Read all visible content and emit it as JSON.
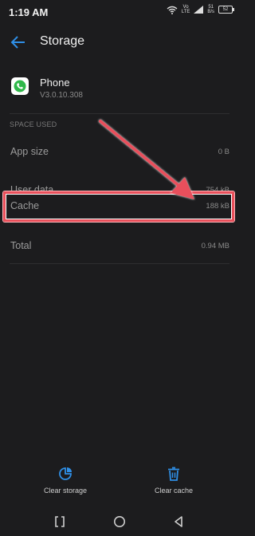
{
  "status_bar": {
    "time": "1:19 AM",
    "network_top": "Vo",
    "network_bottom": "LTE",
    "speed_top": "51",
    "speed_bottom": "B/s",
    "battery": "52"
  },
  "app_bar": {
    "title": "Storage"
  },
  "app": {
    "name": "Phone",
    "version": "V3.0.10.308"
  },
  "section": {
    "label": "SPACE USED"
  },
  "rows": [
    {
      "label": "App size",
      "value": "0 B"
    },
    {
      "label": "User data",
      "value": "754 kB"
    },
    {
      "label": "Cache",
      "value": "188 kB"
    },
    {
      "label": "Total",
      "value": "0.94 MB"
    }
  ],
  "actions": {
    "clear_storage": "Clear storage",
    "clear_cache": "Clear cache"
  },
  "colors": {
    "accent": "#2f8fe6",
    "highlight": "#e8505b",
    "background": "#1c1c1e"
  },
  "icons": [
    "back-arrow-icon",
    "phone-app-icon",
    "clear-storage-icon",
    "trash-icon",
    "recent-apps-icon",
    "home-icon",
    "back-icon",
    "wifi-icon",
    "signal-icon",
    "battery-icon"
  ]
}
